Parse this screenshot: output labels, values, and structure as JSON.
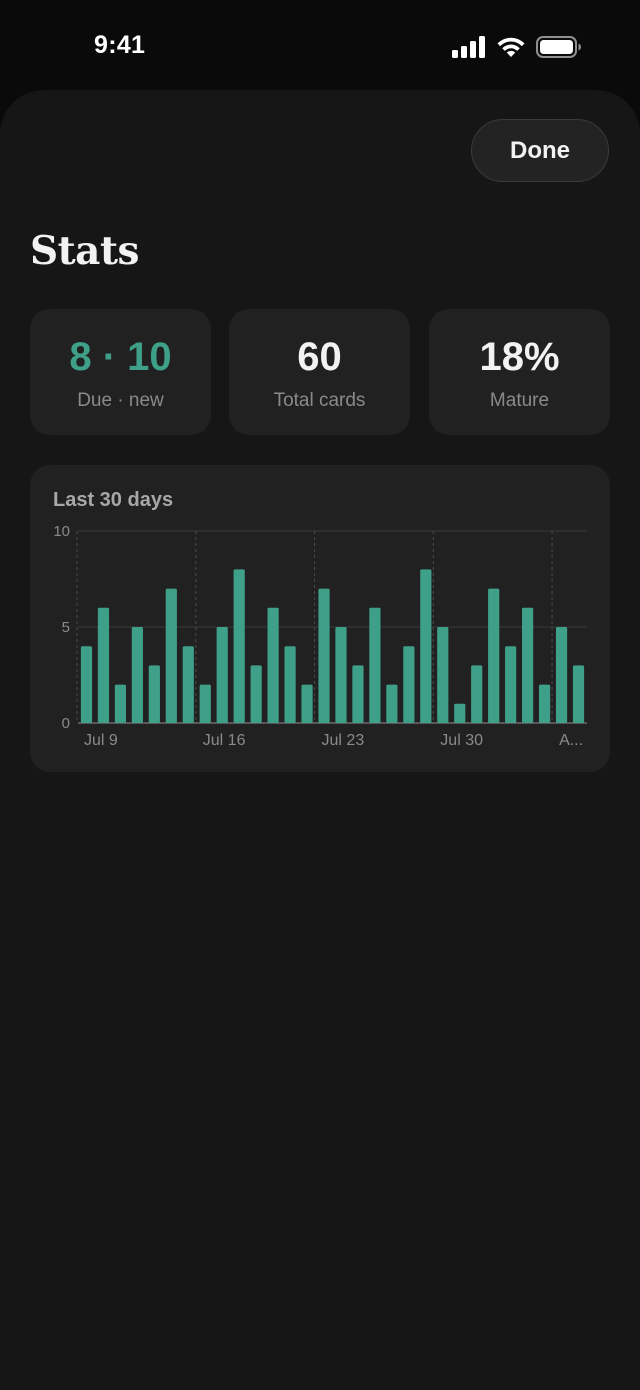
{
  "status_bar": {
    "time": "9:41",
    "icons": [
      "cellular-signal-icon",
      "wifi-icon",
      "battery-icon"
    ]
  },
  "header": {
    "done_label": "Done",
    "title": "Stats"
  },
  "stats": [
    {
      "value": "8 · 10",
      "label": "Due · new",
      "color": "#3fa089"
    },
    {
      "value": "60",
      "label": "Total cards",
      "color": "#f2f2f2"
    },
    {
      "value": "18%",
      "label": "Mature",
      "color": "#f2f2f2"
    }
  ],
  "colors": {
    "accent": "#3fa089",
    "background": "#161616",
    "card": "#222121",
    "text_primary": "#f2f2f2",
    "text_secondary": "#8a8a8a"
  },
  "chart_data": {
    "type": "bar",
    "title": "Last 30 days",
    "xlabel": "",
    "ylabel": "",
    "ylim": [
      0,
      10
    ],
    "y_ticks": [
      "0",
      "5",
      "10"
    ],
    "x_tick_labels": [
      "Jul 9",
      "Jul 16",
      "Jul 23",
      "Jul 30",
      "A..."
    ],
    "x_tick_start_index": [
      0,
      7,
      14,
      21,
      28
    ],
    "grid": true,
    "values": [
      4,
      6,
      2,
      5,
      3,
      7,
      4,
      2,
      5,
      8,
      3,
      6,
      4,
      2,
      7,
      5,
      3,
      6,
      2,
      4,
      8,
      5,
      1,
      3,
      7,
      4,
      6,
      2,
      5,
      3
    ],
    "bar_color": "#3fa089"
  }
}
